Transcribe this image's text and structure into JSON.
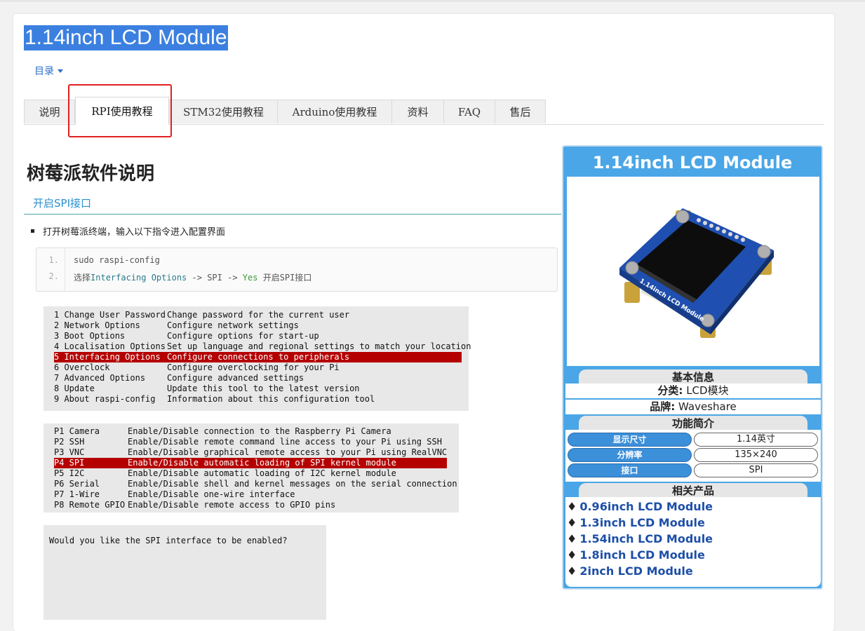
{
  "page": {
    "title": "1.14inch LCD Module",
    "toc_label": "目录"
  },
  "tabs": [
    "说明",
    "RPI使用教程",
    "STM32使用教程",
    "Arduino使用教程",
    "资料",
    "FAQ",
    "售后"
  ],
  "active_tab": "RPI使用教程",
  "section": {
    "heading": "树莓派软件说明",
    "subheading": "开启SPI接口",
    "bullet": "打开树莓派终端，输入以下指令进入配置界面"
  },
  "code": {
    "line_numbers": [
      "1.",
      "2."
    ],
    "line1": "sudo raspi-config",
    "line2_prefix": "选择",
    "line2_kw1": "Interfacing Options",
    "line2_arrow1": " -> SPI -> ",
    "line2_kw2": "Yes",
    "line2_suffix": " 开启SPI接口"
  },
  "terminal_menu": {
    "rows": [
      {
        "key": "1 Change User Password",
        "desc": "Change password for the current user"
      },
      {
        "key": "2 Network Options",
        "desc": "Configure network settings"
      },
      {
        "key": "3 Boot Options",
        "desc": "Configure options for start-up"
      },
      {
        "key": "4 Localisation Options",
        "desc": "Set up language and regional settings to match your location"
      },
      {
        "key": "5 Interfacing Options",
        "desc": "Configure connections to peripherals"
      },
      {
        "key": "6 Overclock",
        "desc": "Configure overclocking for your Pi"
      },
      {
        "key": "7 Advanced Options",
        "desc": "Configure advanced settings"
      },
      {
        "key": "8 Update",
        "desc": "Update this tool to the latest version"
      },
      {
        "key": "9 About raspi-config",
        "desc": "Information about this configuration tool"
      }
    ],
    "highlighted": "5 Interfacing Options"
  },
  "terminal_interfaces": {
    "rows": [
      {
        "key": "P1 Camera",
        "desc": "Enable/Disable connection to the Raspberry Pi Camera"
      },
      {
        "key": "P2 SSH",
        "desc": "Enable/Disable remote command line access to your Pi using SSH"
      },
      {
        "key": "P3 VNC",
        "desc": "Enable/Disable graphical remote access to your Pi using RealVNC"
      },
      {
        "key": "P4 SPI",
        "desc": "Enable/Disable automatic loading of SPI kernel module"
      },
      {
        "key": "P5 I2C",
        "desc": "Enable/Disable automatic loading of I2C kernel module"
      },
      {
        "key": "P6 Serial",
        "desc": "Enable/Disable shell and kernel messages on the serial connection"
      },
      {
        "key": "P7 1-Wire",
        "desc": "Enable/Disable one-wire interface"
      },
      {
        "key": "P8 Remote GPIO",
        "desc": "Enable/Disable remote access to GPIO pins"
      }
    ],
    "highlighted": "P4 SPI"
  },
  "terminal_prompt": {
    "text": "Would you like the SPI interface to be enabled?"
  },
  "infobox": {
    "title": "1.14inch LCD Module",
    "board_label": "1.14inch LCD Module",
    "basic_header": "基本信息",
    "category_key": "分类:",
    "category_val": "LCD模块",
    "brand_key": "品牌:",
    "brand_val": "Waveshare",
    "features_header": "功能简介",
    "specs": [
      {
        "key": "显示尺寸",
        "val": "1.14英寸"
      },
      {
        "key": "分辨率",
        "val": "135×240"
      },
      {
        "key": "接口",
        "val": "SPI"
      }
    ],
    "related_header": "相关产品",
    "related": [
      "0.96inch LCD Module",
      "1.3inch LCD Module",
      "1.54inch LCD Module",
      "1.8inch LCD Module",
      "2inch LCD Module"
    ],
    "colors": {
      "accent": "#4aa6e6",
      "link": "#1d4fa8",
      "highlight": "#b50000",
      "page_title_bg": "#3b80e0"
    }
  }
}
